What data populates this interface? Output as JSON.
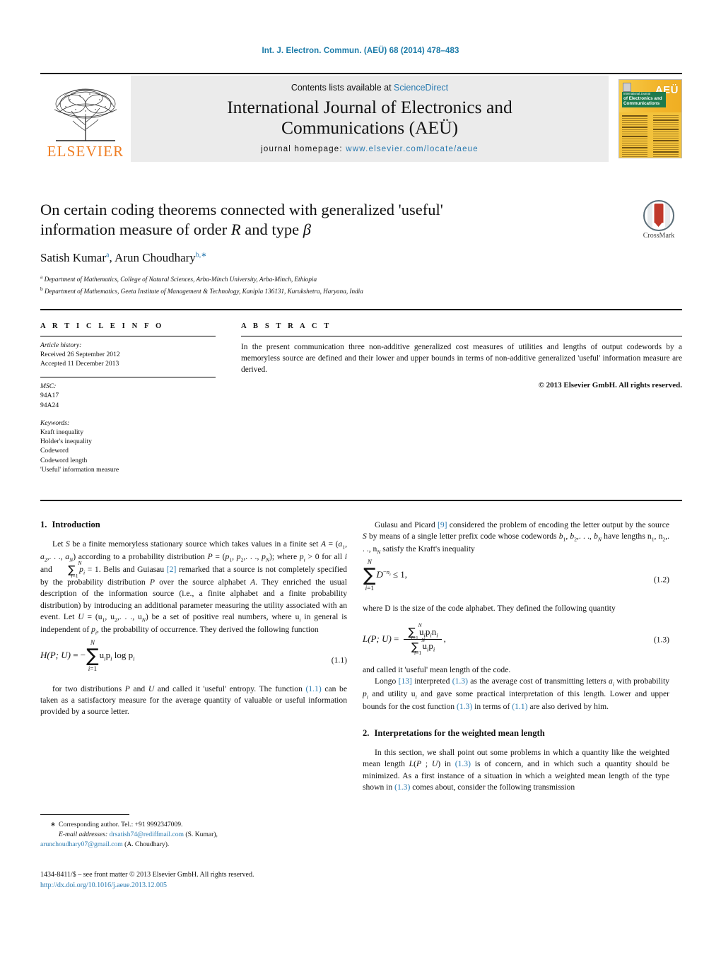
{
  "running_head": "Int. J. Electron. Commun. (AEÜ) 68 (2014) 478–483",
  "masthead": {
    "publisher": "ELSEVIER",
    "contents_prefix": "Contents lists available at ",
    "contents_link": "ScienceDirect",
    "journal_title_line1": "International Journal of Electronics and",
    "journal_title_line2": "Communications (AEÜ)",
    "homepage_label": "journal homepage:",
    "homepage_url": "www.elsevier.com/locate/aeue",
    "cover": {
      "badge": "AEÜ",
      "line_small": "International Journal",
      "line1": "of Electronics and",
      "line2": "Communications"
    }
  },
  "title_block": {
    "title_line1": "On certain coding theorems connected with generalized 'useful'",
    "title_line2_pre": "information measure of order ",
    "title_order_symbol": "R",
    "title_line2_mid": " and type ",
    "title_type_symbol": "β",
    "authors": [
      {
        "name": "Satish Kumar",
        "marks": "a"
      },
      {
        "name": "Arun Choudhary",
        "marks": "b,∗"
      }
    ],
    "affiliations": [
      {
        "mark": "a",
        "text": "Department of Mathematics, College of Natural Sciences, Arba-Minch University, Arba-Minch, Ethiopia"
      },
      {
        "mark": "b",
        "text": "Department of Mathematics, Geeta Institute of Management & Technology, Kanipla 136131, Kurukshetra, Haryana, India"
      }
    ],
    "crossmark_label": "CrossMark"
  },
  "article_info": {
    "heading": "A R T I C L E   I N F O",
    "history_label": "Article history:",
    "history": [
      "Received 26 September 2012",
      "Accepted 11 December 2013"
    ],
    "msc_label": "MSC:",
    "msc": [
      "94A17",
      "94A24"
    ],
    "keywords_label": "Keywords:",
    "keywords": [
      "Kraft inequality",
      "Holder's inequality",
      "Codeword",
      "Codeword length",
      "'Useful' information measure"
    ]
  },
  "abstract": {
    "heading": "A B S T R A C T",
    "text": "In the present communication three non-additive generalized cost measures of utilities and lengths of output codewords by a memoryless source are defined and their lower and upper bounds in terms of non-additive generalized 'useful' information measure are derived.",
    "copyright": "© 2013 Elsevier GmbH. All rights reserved."
  },
  "sections": {
    "intro_number": "1.",
    "intro_title": "Introduction",
    "weighted_number": "2.",
    "weighted_title": "Interpretations for the weighted mean length"
  },
  "left_column": {
    "p1_a": "Let S be a finite memoryless stationary source which takes values in a finite set A = (a",
    "p1_text": "Let S be a finite memoryless stationary source which takes values in a finite set A = (a1, a2,. . ., aN) according to a probability distribution P = (p1, p2,. . ., pN); where pi > 0 for all i and ∑ pi = 1. Belis and Guiasau [2] remarked that a source is not completely specified by the probability distribution P over the source alphabet A. They enriched the usual description of the information source (i.e., a finite alphabet and a finite probability distribution) by introducing an additional parameter measuring the utility associated with an event. Let U = (u1, u2,. . ., uN) be a set of positive real numbers, where ui in general is independent of pi, the probability of occurrence. They derived the following function",
    "ref_belis": "[2]",
    "eq11_number": "(1.1)",
    "p2_text": "for two distributions P and U and called it 'useful' entropy. The function (1.1) can be taken as a satisfactory measure for the average quantity of valuable or useful information provided by a source letter.",
    "eq11_ref": "(1.1)"
  },
  "right_column": {
    "p1_text": "Gulasu and Picard [9] considered the problem of encoding the letter output by the source S by means of a single letter prefix code whose codewords b1, b2,. . ., bN have lengths n1, n2,. . ., nN satisfy the Kraft's inequality",
    "ref_gulasu": "[9]",
    "eq12_number": "(1.2)",
    "p2_text": "where D is the size of the code alphabet. They defined the following quantity",
    "eq13_number": "(1.3)",
    "p3_text": "and called it 'useful' mean length of the code.",
    "p4_text": "Longo [13] interpreted (1.3) as the average cost of transmitting letters ai with probability pi and utility ui and gave some practical interpretation of this length. Lower and upper bounds for the cost function (1.3) in terms of (1.1) are also derived by him.",
    "ref_longo": "[13]",
    "p5_text": "In this section, we shall point out some problems in which a quantity like the weighted mean length L(P; U) in (1.3) is of concern, and in which such a quantity should be minimized. As a first instance of a situation in which a weighted mean length of the type shown in (1.3) comes about, consider the following transmission"
  },
  "footnotes": {
    "corresponding": "Corresponding author. Tel.: +91 9992347009.",
    "star": "∗",
    "email_label": "E-mail addresses:",
    "email1": "drsatish74@rediffmail.com",
    "email1_owner": "(S. Kumar),",
    "email2": "arunchoudhary07@gmail.com",
    "email2_owner": "(A. Choudhary).",
    "issn_line": "1434-8411/$ – see front matter © 2013 Elsevier GmbH. All rights reserved.",
    "doi": "http://dx.doi.org/10.1016/j.aeue.2013.12.005"
  },
  "colors": {
    "link": "#2a7ab0",
    "elsevier_orange": "#ef7d22",
    "crossmark_red": "#c0392b"
  }
}
